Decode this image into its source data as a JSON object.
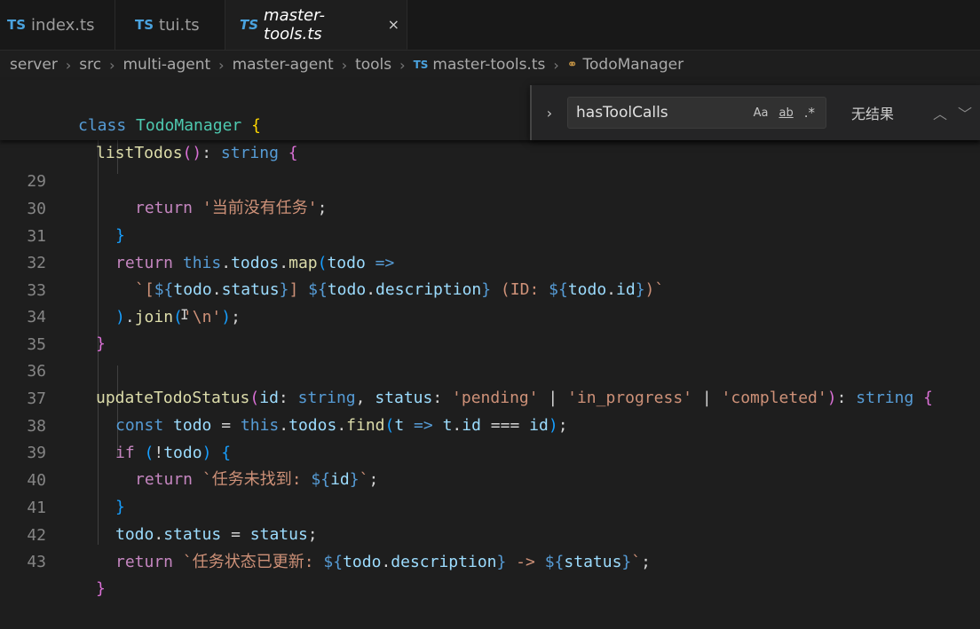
{
  "tabs": [
    {
      "icon": "TS",
      "label": "index.ts"
    },
    {
      "icon": "TS",
      "label": "tui.ts"
    },
    {
      "icon": "TS",
      "label": "master-tools.ts",
      "close": "×"
    }
  ],
  "breadcrumb": {
    "items": [
      "server",
      "src",
      "multi-agent",
      "master-agent",
      "tools"
    ],
    "file_icon": "TS",
    "file": "master-tools.ts",
    "symbol_icon": "symbol-class-icon",
    "symbol": "TodoManager"
  },
  "find_widget": {
    "query": "hasToolCalls",
    "match_case": "Aa",
    "whole_word": "ab",
    "regex": ".*",
    "result": "无结果",
    "prev": "⌃",
    "next": "⌄"
  },
  "editor": {
    "sticky": [
      "class TodoManager {",
      "listTodos(): string {"
    ],
    "line_numbers": [
      "29",
      "30",
      "31",
      "32",
      "33",
      "34",
      "35",
      "36",
      "37",
      "38",
      "39",
      "40",
      "41",
      "42",
      "43"
    ],
    "strings": {
      "empty": "'当前没有任务'",
      "newline": "'\\n'",
      "pending": "'pending'",
      "in_progress": "'in_progress'",
      "completed": "'completed'",
      "not_found": "`任务未找到: ",
      "updated": "`任务状态已更新: "
    }
  },
  "colors": {
    "background": "#1e1e1e",
    "keyword": "#569cd6",
    "control": "#c586c0",
    "function": "#dcdcaa",
    "string": "#ce9178",
    "variable": "#9cdcfe"
  }
}
